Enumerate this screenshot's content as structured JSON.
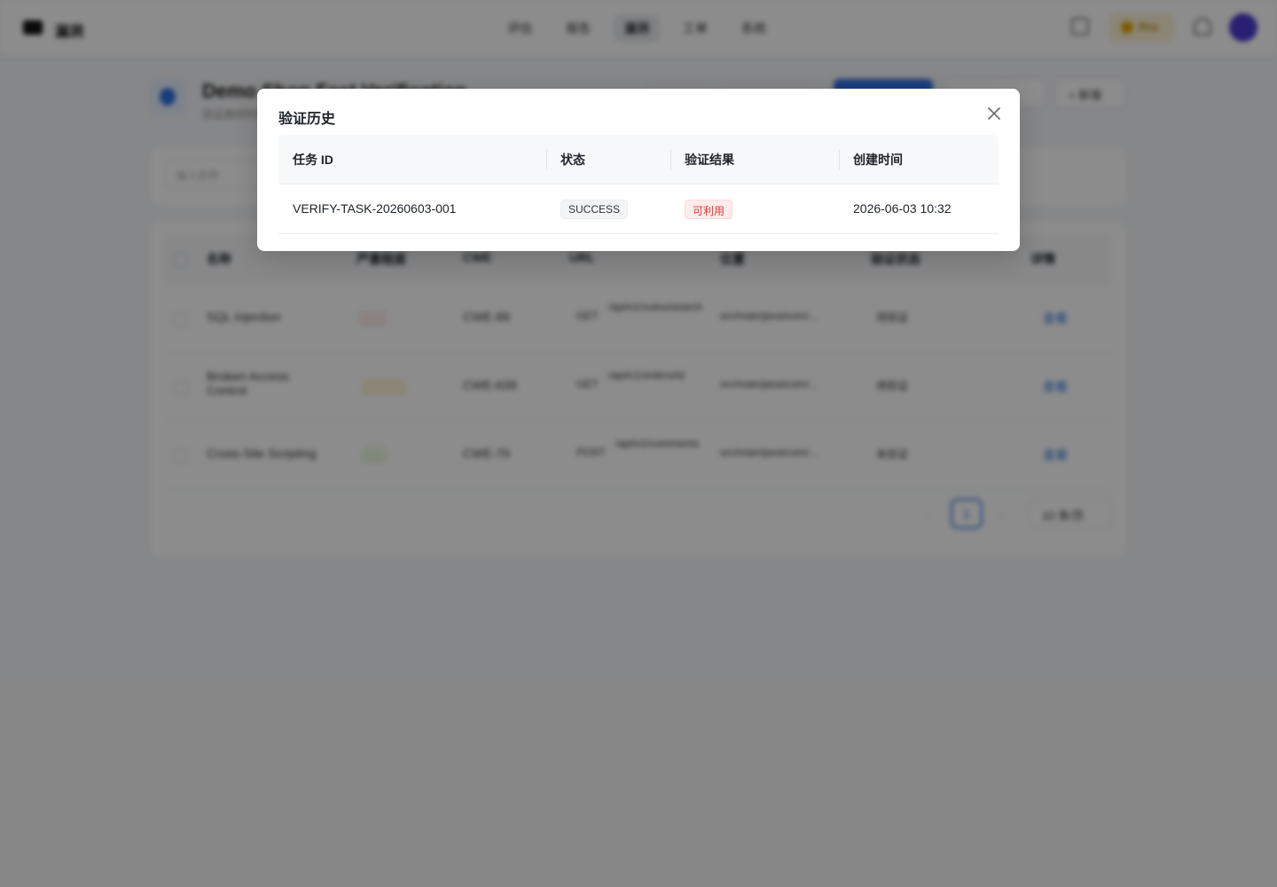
{
  "background": {
    "brand": "漏洞",
    "nav": [
      "评估",
      "报告",
      "漏洞",
      "工单",
      "系统"
    ],
    "nav_active_index": 2,
    "pro_label": "Pro",
    "project": {
      "title": "Demo Shop Fast Verification",
      "subtitle": "验证漏洞列表"
    },
    "add_button": "新增",
    "filter_placeholder": "输入名称",
    "table_headers": [
      "名称",
      "严重程度",
      "CWE",
      "URL",
      "位置",
      "验证状态",
      "详情"
    ],
    "rows": [
      {
        "name": "SQL Injection",
        "severity": "high",
        "cwe": "CWE-89",
        "method": "GET",
        "url": "/api/v1/vulns/search",
        "location": "src/main/java/com/...",
        "status": "待验证",
        "action": "查看"
      },
      {
        "name": "Broken Access Control",
        "severity": "medium",
        "cwe": "CWE-639",
        "method": "GET",
        "url": "/api/v1/orders/id",
        "location": "src/main/java/com/...",
        "status": "待验证",
        "action": "查看"
      },
      {
        "name": "Cross-Site Scripting",
        "severity": "low",
        "cwe": "CWE-79",
        "method": "POST",
        "url": "/api/v1/comments",
        "location": "src/main/java/com/...",
        "status": "未验证",
        "action": "查看"
      }
    ],
    "page": "1",
    "page_size": "10 条/页"
  },
  "colors": {
    "primary": "#2f6fe0",
    "high": "#e53935",
    "medium": "#e0a800",
    "low": "#52c41a",
    "mask": "rgba(0,0,0,0.45)"
  },
  "modal": {
    "title": "验证历史",
    "close_icon": "close-icon",
    "columns": [
      "任务 ID",
      "状态",
      "验证结果",
      "创建时间"
    ],
    "rows": [
      {
        "task_id": "VERIFY-TASK-20260603-001",
        "status": "SUCCESS",
        "result": "可利用",
        "created_at": "2026-06-03 10:32"
      }
    ]
  }
}
